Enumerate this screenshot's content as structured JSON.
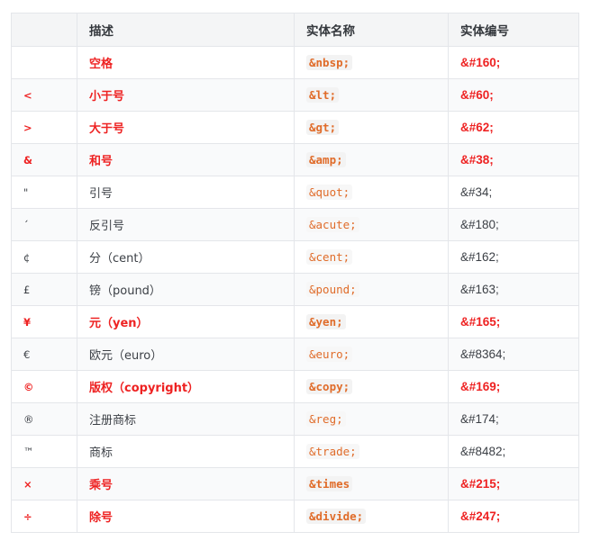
{
  "table": {
    "headers": [
      "",
      "描述",
      "实体名称",
      "实体编号"
    ],
    "rows": [
      {
        "char": "",
        "desc": "空格",
        "name": "&nbsp;",
        "num": "&#160;",
        "hi": true
      },
      {
        "char": "<",
        "desc": "小于号",
        "name": "&lt;",
        "num": "&#60;",
        "hi": true
      },
      {
        "char": ">",
        "desc": "大于号",
        "name": "&gt;",
        "num": "&#62;",
        "hi": true
      },
      {
        "char": "&",
        "desc": "和号",
        "name": "&amp;",
        "num": "&#38;",
        "hi": true
      },
      {
        "char": "\"",
        "desc": "引号",
        "name": "&quot;",
        "num": "&#34;",
        "hi": false
      },
      {
        "char": "´",
        "desc": "反引号",
        "name": "&acute;",
        "num": "&#180;",
        "hi": false
      },
      {
        "char": "¢",
        "desc": "分（cent）",
        "name": "&cent;",
        "num": "&#162;",
        "hi": false
      },
      {
        "char": "£",
        "desc": "镑（pound）",
        "name": "&pound;",
        "num": "&#163;",
        "hi": false
      },
      {
        "char": "¥",
        "desc": "元（yen）",
        "name": "&yen;",
        "num": "&#165;",
        "hi": true
      },
      {
        "char": "€",
        "desc": "欧元（euro）",
        "name": "&euro;",
        "num": "&#8364;",
        "hi": false
      },
      {
        "char": "©",
        "desc": "版权（copyright）",
        "name": "&copy;",
        "num": "&#169;",
        "hi": true
      },
      {
        "char": "®",
        "desc": "注册商标",
        "name": "&reg;",
        "num": "&#174;",
        "hi": false
      },
      {
        "char": "™",
        "desc": "商标",
        "name": "&trade;",
        "num": "&#8482;",
        "hi": false
      },
      {
        "char": "×",
        "desc": "乘号",
        "name": "&times",
        "num": "&#215;",
        "hi": true
      },
      {
        "char": "÷",
        "desc": "除号",
        "name": "&divide;",
        "num": "&#247;",
        "hi": true
      }
    ]
  },
  "colors": {
    "highlight_text": "#ee2222",
    "entity_code": "#e06c2a",
    "header_bg": "#f4f5f6",
    "border": "#e4e6ea"
  }
}
